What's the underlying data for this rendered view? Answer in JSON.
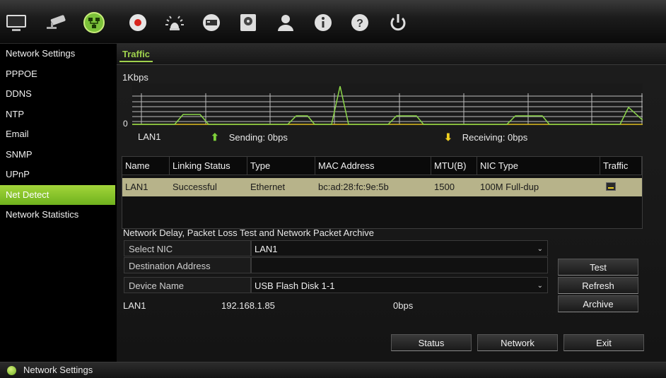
{
  "toolbar": {
    "icons": [
      "monitor-icon",
      "camera-icon",
      "network-icon",
      "record-icon",
      "alarm-icon",
      "device-icon",
      "storage-icon",
      "user-icon",
      "info-icon",
      "help-icon",
      "power-icon"
    ],
    "active_icon": "network-icon"
  },
  "sidebar": {
    "items": [
      {
        "label": "Network Settings"
      },
      {
        "label": "PPPOE"
      },
      {
        "label": "DDNS"
      },
      {
        "label": "NTP"
      },
      {
        "label": "Email"
      },
      {
        "label": "SNMP"
      },
      {
        "label": "UPnP"
      },
      {
        "label": "Net Detect",
        "active": true
      },
      {
        "label": "Network Statistics"
      }
    ]
  },
  "tab": {
    "label": "Traffic"
  },
  "chart": {
    "y_top_label": "1Kbps",
    "y_zero_label": "0",
    "interface_label": "LAN1",
    "sending_label": "Sending: 0bps",
    "receiving_label": "Receiving: 0bps",
    "sending_arrow": "⬆",
    "receiving_arrow": "⬇",
    "sending_color": "#7fd13b",
    "receiving_color": "#f0d020"
  },
  "table": {
    "headers": [
      "Name",
      "Linking Status",
      "Type",
      "MAC Address",
      "MTU(B)",
      "NIC Type",
      "Traffic"
    ],
    "rows": [
      {
        "name": "LAN1",
        "status": "Successful",
        "type": "Ethernet",
        "mac": "bc:ad:28:fc:9e:5b",
        "mtu": "1500",
        "nic_type": "100M Full-dup"
      }
    ]
  },
  "section": {
    "title": "Network Delay, Packet Loss Test and Network Packet Archive"
  },
  "form": {
    "select_nic_label": "Select NIC",
    "select_nic_value": "LAN1",
    "destination_label": "Destination Address",
    "destination_value": "",
    "device_label": "Device Name",
    "device_value": "USB Flash Disk 1-1"
  },
  "buttons": {
    "test": "Test",
    "refresh": "Refresh",
    "archive": "Archive",
    "status": "Status",
    "network": "Network",
    "exit": "Exit"
  },
  "info": {
    "interface": "LAN1",
    "ip": "192.168.1.85",
    "rate": "0bps"
  },
  "statusbar": {
    "text": "Network Settings"
  },
  "colors": {
    "accent_green": "#8cc63f",
    "selected_row": "#b7b38a"
  }
}
